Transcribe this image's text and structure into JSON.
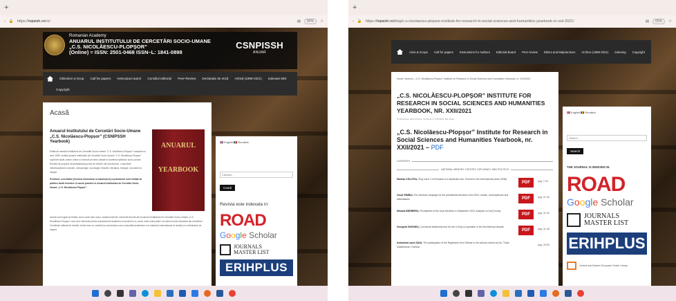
{
  "win1": {
    "tab_plus": "+",
    "url_prefix": "https://",
    "url_host": "inpsish.ro",
    "url_path": "/ro/",
    "zoom": "80%",
    "header": {
      "academy": "Romanian Academy",
      "title_line1": "ANUARUL INSTITUTULUI DE CERCETĂRI SOCIO-UMANE",
      "title_line2": "„C.S. NICOLĂESCU-PLOPȘOR”",
      "issn": "(Online) = ISSN: 2501-0468 ISSN–L: 1841-0898",
      "brand": "CSNPISSH",
      "brand_sub": "ANUAR"
    },
    "nav": [
      "Obiective și Scop",
      "Call for papers",
      "Instrucțiuni autori",
      "Consiliul editorial",
      "Peer-Review",
      "Declarație de etică",
      "Arhivă (1999-2021)",
      "Indexare BDI",
      "Copyright"
    ],
    "main": {
      "heading": "Acasă",
      "article_title": "Anuarul Institutului de Cercetări Socio-Umane „C.S. Nicolăescu-Plopșor” (CSNIPSSH Yearbook)",
      "p1": "Editat de membrii Institutului de Cercetări Socio-Umane \"C.S. Nicolăescu-Plopșor\" începând cu anul 1999, revista Anuarul Institutului de Cercetări Socio-Umane \"C.S. Nicolăescu-Plopșor\" cuprinde studii, eseuri critice și recenzii pe teme variate le domeniul științelor socio-umane. Revista își propune să dezbateasă puncte de vedere cât mai diverse, o abordare interdisciplinară a istoriei, antropologie, sociologie, filosofie, literatura, teologie, economie și dreptul.",
      "p2": "Profesori, cercetători (inclusiv doctoranzi și masteranzi) și practicieni sunt invitați să publice studii teoretice și cazuri practice în Anuarul Institutului de Cercetări Socio-Umane „C.S. Nicolăescu-Plopșor”.",
      "p3": "Autorii sunt rugați să trimită, acolo unde este cazul, odată lucrări din numerele trecute ale Anuarului Institutului de Cercetări Socio-Umane „C.S. Nicolăescu-Plopșor” care sunt relevante pentru subdomeniul academic al lucrării lor și, acolo unde este posibil, să citeze lucrări relevante ale membrilor Consiliului editorial al revistei. Acest lucru ar contribui la construirea unei comunități academice și a statutului internațional al revistei și a referințelor de impact.",
      "book_title": "ANUARUL",
      "book_sub": "YEARBOOK"
    },
    "sidebar": {
      "lang_en": "English",
      "lang_ro": "Română",
      "search_placeholder": "Căutare...",
      "search_button": "Caută",
      "indexed_heading": "Revista este indexata in:",
      "road": "ROAD",
      "journals": "JOURNALS",
      "master_list": "MASTER LIST",
      "erih": "ERIHPLUS"
    }
  },
  "win2": {
    "tab_plus": "+",
    "url_prefix": "https://",
    "url_host": "inpsish.ro",
    "url_path": "/blog/c-s-nicolaescu-plopsor-institute-for-research-in-social-sciences-and-humanities-yearbook-nr-xxii-2021/",
    "zoom": "65%",
    "nav": [
      "Aims & Scope",
      "Call for papers",
      "Instructions for Authors",
      "Editorial Board",
      "Peer-review",
      "Ethics and Malpractices",
      "Archive (1999-2021)",
      "Indexing",
      "Copyright"
    ],
    "breadcrumb": "Home / Archive / „C.S. Nicolăescu-Plopșor” Institute for Research in Social Sciences and Humanities Yearbook, nr. XXII/2021",
    "title": "„C.S. NICOLĂESCU-PLOPȘOR” INSTITUTE FOR RESEARCH IN SOCIAL SCIENCES AND HUMANITIES YEARBOOK, NR. XXII/2021",
    "meta": "10 December 2021   Archive, Yearbook nr. XXII/2021   262 Views",
    "subtitle": "„C.S. Nicolăescu-Plopșor” Institute for Research in Social Sciences and Humanities Yearbook, nr. XXII/2021 –",
    "pdf_link": "PDF",
    "contents": "CONTENTS",
    "section": "NATIONAL MEMORY. HISTORY, DIPLOMACY AND POLITICS",
    "articles": [
      {
        "author": "Mariuța CĂLUTEA,",
        "text": "King Carol II of Romania in a diplomatic tour. Echoes in the international press (1938)",
        "pages": "pag. 7-20"
      },
      {
        "author": "Oscar RIMBAI,",
        "text": "The electoral campaign for the presidential elections from 2004: results, consequences and delimitations",
        "pages": "pag. 21-30"
      },
      {
        "author": "Mihaela BĂRBIERU,",
        "text": "Peculiarities of the local elections in September 2020. Analysis on Dolj County",
        "pages": "pag. 31-40"
      },
      {
        "author": "Georgeta GHIONEA,",
        "text": "Communal leadership and its role in Dolj co-operation in the first interwar decade",
        "pages": "pag. 41-48"
      },
      {
        "author": "Antoanela Laura SAVA,",
        "text": "The participation of the Regiments from Oltenia to the actions carried out by \"Tudor Vladimirescu\" Division",
        "pages": "pag. 49-59"
      }
    ],
    "pdf_icon": "PDF",
    "sidebar": {
      "lang_en": "English",
      "lang_ro": "Română",
      "search_placeholder": "Search ...",
      "search_button": "Search",
      "indexed_heading": "THE JOURNAL IS INDEXED IN",
      "road": "ROAD",
      "journals": "JOURNALS",
      "master_list": "MASTER LIST",
      "erih": "ERIHPLUS",
      "ceel": "Central and Eastern European Online Library"
    }
  },
  "google": {
    "G": "G",
    "o1": "o",
    "o2": "o",
    "g": "g",
    "l": "l",
    "e": "e",
    "scholar": " Scholar"
  },
  "colors": {
    "road_red": "#d2232a",
    "erih_blue": "#1c3f7c",
    "pdf_red": "#c8161d",
    "link_blue": "#1565c0"
  }
}
